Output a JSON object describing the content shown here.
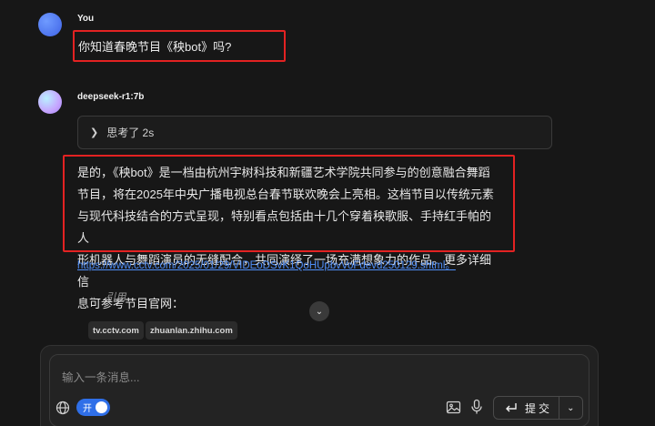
{
  "conversation": {
    "user": {
      "name": "You",
      "message": "你知道春晚节目《秧bot》吗?"
    },
    "bot": {
      "name": "deepseek-r1:7b",
      "thinking_label": "思考了 2s",
      "answer_lines": [
        "是的，《秧bot》是一档由杭州宇树科技和新疆艺术学院共同参与的创意融合舞蹈",
        "节目，将在2025年中央广播电视总台春节联欢晚会上亮相。这档节目以传统元素",
        "与现代科技结合的方式呈现，特别看点包括由十几个穿着秧歌服、手持红手帕的人",
        "形机器人与舞蹈演员的无缝配合，共同演绎了一场充满想象力的作品。更多详细信",
        "息可参考节目官网："
      ],
      "url": "https://www.cctv.com/2025/01/29/VIDEoDSvK1QoHUpbvVoFdevd250129.shtml。",
      "citation_label": "引用",
      "sources": [
        "tv.cctv.com",
        "zhuanlan.zhihu.com"
      ]
    }
  },
  "composer": {
    "placeholder": "输入一条消息...",
    "web_toggle_label": "开",
    "send_label": "提交"
  },
  "colors": {
    "background": "#171717",
    "highlight_border": "#e32222",
    "link": "#4f8ef7",
    "toggle_on": "#2f6fe8"
  }
}
